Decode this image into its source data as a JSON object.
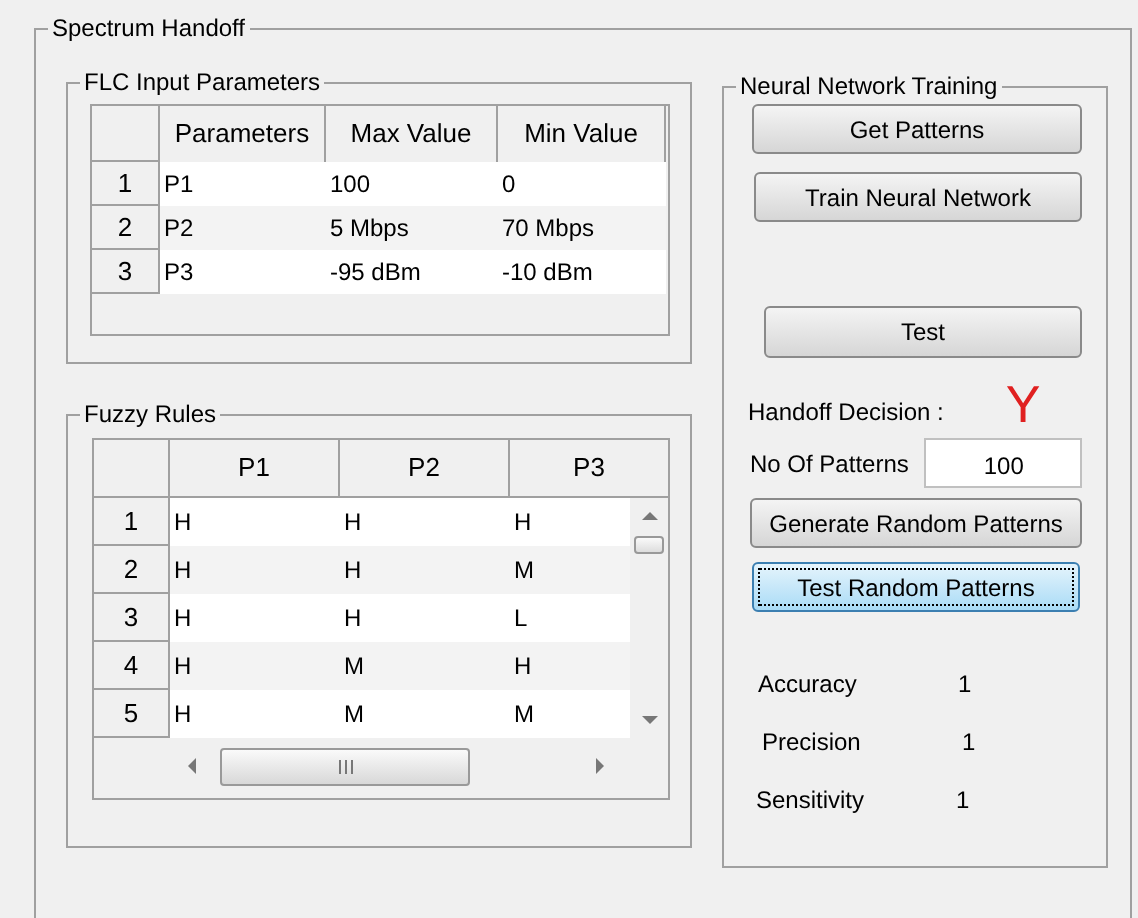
{
  "panel": {
    "title": "Spectrum Handoff"
  },
  "flc_input_parameters": {
    "title": "FLC Input Parameters",
    "columns": [
      "Parameters",
      "Max Value",
      "Min Value"
    ],
    "rows": [
      {
        "header": "1",
        "cells": [
          "P1",
          "100",
          "0"
        ]
      },
      {
        "header": "2",
        "cells": [
          "P2",
          "5 Mbps",
          "70 Mbps"
        ]
      },
      {
        "header": "3",
        "cells": [
          "P3",
          "-95 dBm",
          "-10 dBm"
        ]
      }
    ]
  },
  "fuzzy_rules": {
    "title": "Fuzzy Rules",
    "columns": [
      "P1",
      "P2",
      "P3"
    ],
    "rows": [
      {
        "header": "1",
        "cells": [
          "H",
          "H",
          "H"
        ]
      },
      {
        "header": "2",
        "cells": [
          "H",
          "H",
          "M"
        ]
      },
      {
        "header": "3",
        "cells": [
          "H",
          "H",
          "L"
        ]
      },
      {
        "header": "4",
        "cells": [
          "H",
          "M",
          "H"
        ]
      },
      {
        "header": "5",
        "cells": [
          "H",
          "M",
          "M"
        ]
      }
    ]
  },
  "neural_network_training": {
    "title": "Neural Network Training",
    "buttons_top": [
      {
        "label": "Get Patterns",
        "focused": false
      },
      {
        "label": "Train Neural Network",
        "focused": false
      }
    ],
    "test_button": {
      "label": "Test",
      "focused": false
    },
    "handoff_decision": {
      "label": "Handoff Decision :",
      "value": "Y"
    },
    "patterns_field": {
      "label": "No Of Patterns",
      "value": "100"
    },
    "buttons_bottom": [
      {
        "label": "Generate Random Patterns",
        "focused": false
      },
      {
        "label": "Test Random Patterns",
        "focused": true
      }
    ],
    "metrics": [
      {
        "label": "Accuracy",
        "value": "1"
      },
      {
        "label": "Precision",
        "value": "1"
      },
      {
        "label": "Sensitivity",
        "value": "1"
      }
    ]
  }
}
